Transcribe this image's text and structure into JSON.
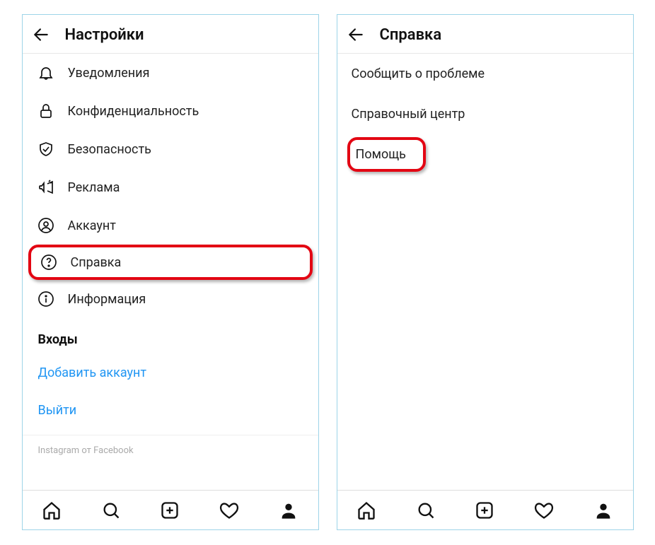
{
  "screen_left": {
    "title": "Настройки",
    "items": {
      "notifications": "Уведомления",
      "privacy": "Конфиденциальность",
      "security": "Безопасность",
      "ads": "Реклама",
      "account": "Аккаунт",
      "help": "Справка",
      "info": "Информация"
    },
    "section_logins": "Входы",
    "add_account": "Добавить аккаунт",
    "logout": "Выйти",
    "footer": "Instagram от Facebook"
  },
  "screen_right": {
    "title": "Справка",
    "items": {
      "report": "Сообщить  о проблеме",
      "help_center": "Справочный центр",
      "support": "Помощь"
    }
  }
}
